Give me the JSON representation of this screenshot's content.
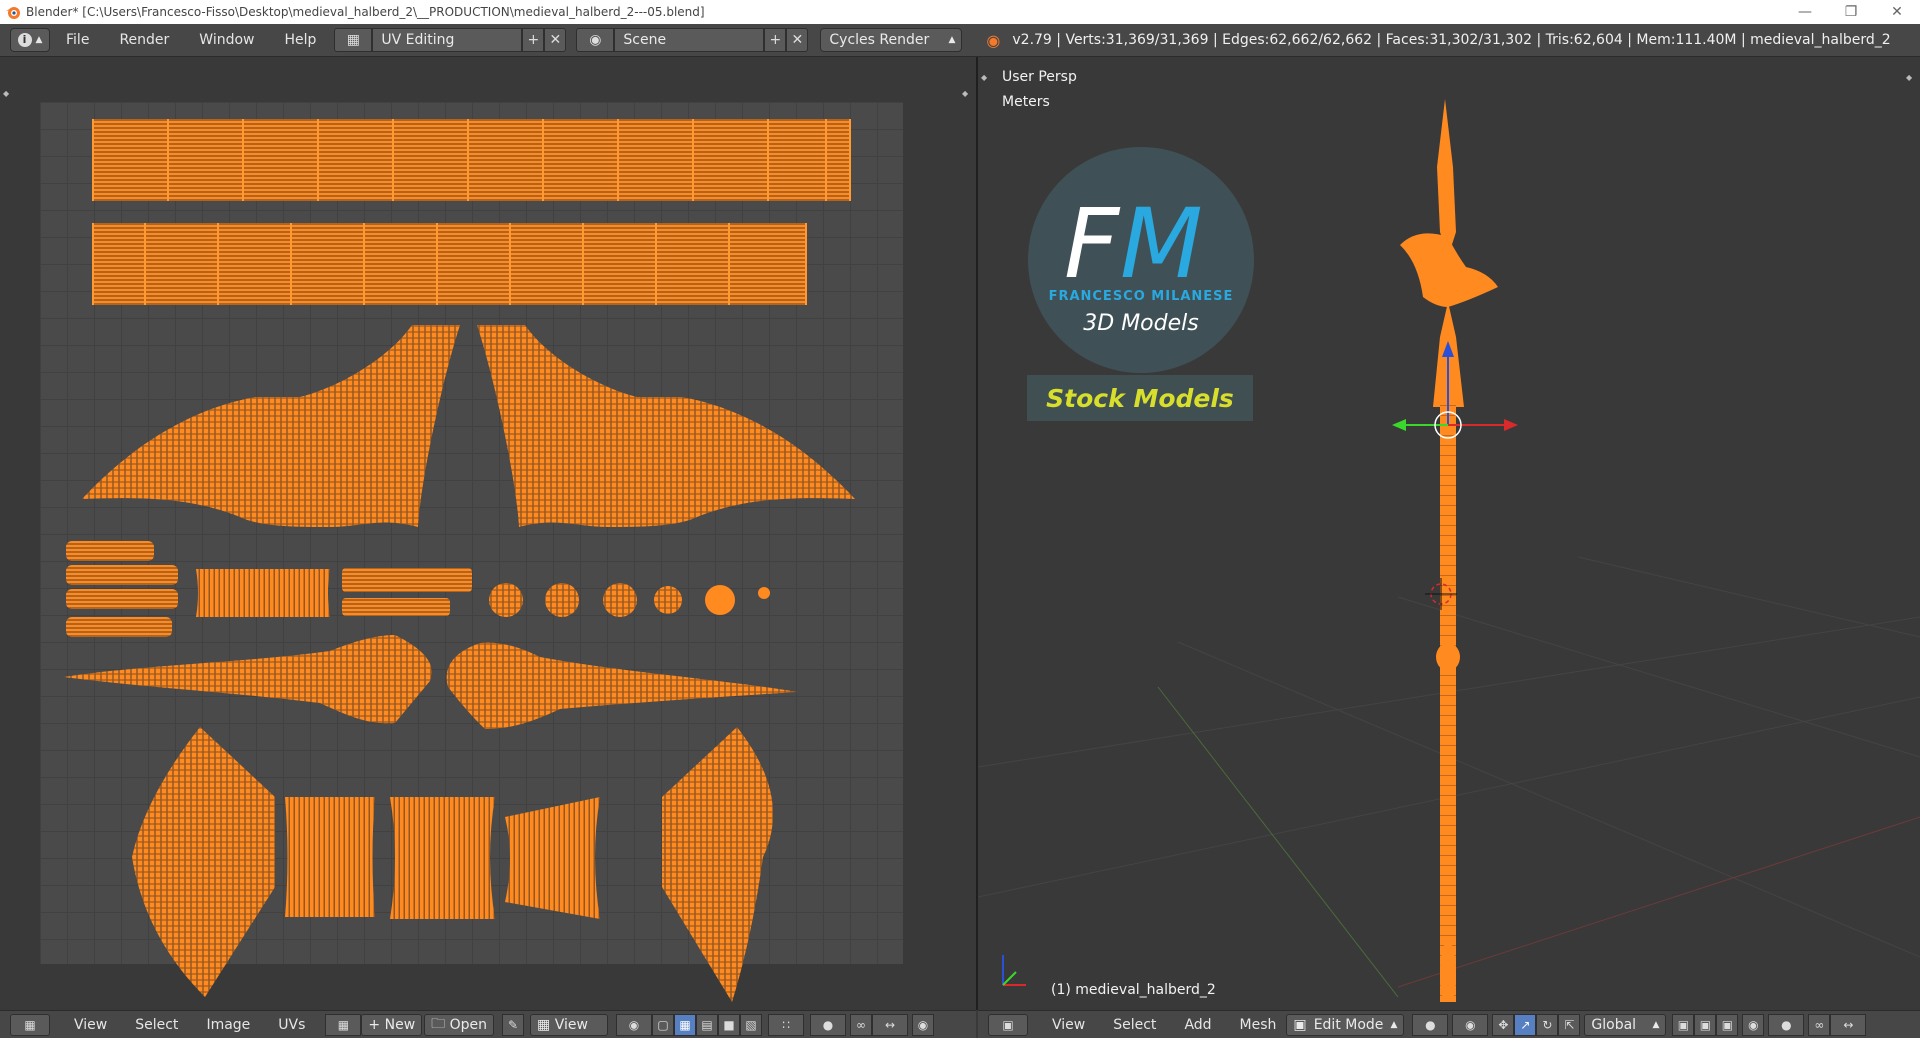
{
  "window": {
    "title": "Blender* [C:\\Users\\Francesco-Fisso\\Desktop\\medieval_halberd_2\\__PRODUCTION\\medieval_halberd_2---05.blend]",
    "minimize_icon": "minimize-icon",
    "restore_icon": "restore-icon",
    "close_icon": "close-icon"
  },
  "menu": {
    "file": "File",
    "render": "Render",
    "window": "Window",
    "help": "Help"
  },
  "layout": {
    "screen_name": "UV Editing",
    "scene_name": "Scene"
  },
  "render_engine": "Cycles Render",
  "stats": "v2.79 | Verts:31,369/31,369 | Edges:62,662/62,662 | Faces:31,302/31,302 | Tris:62,604 | Mem:111.40M | medieval_halberd_2",
  "viewport": {
    "view_label": "User Persp",
    "units_label": "Meters",
    "object_label": "(1) medieval_halberd_2"
  },
  "watermark": {
    "monogram_f": "F",
    "monogram_m": "M",
    "name": "FRANCESCO MILANESE",
    "tagline": "3D Models",
    "badge": "Stock Models"
  },
  "uv_header": {
    "view": "View",
    "select": "Select",
    "image": "Image",
    "uvs": "UVs",
    "new": "New",
    "open": "Open",
    "view2": "View"
  },
  "view3d_header": {
    "view": "View",
    "select": "Select",
    "add": "Add",
    "mesh": "Mesh",
    "mode": "Edit Mode",
    "orientation": "Global"
  },
  "colors": {
    "uv_orange": "#ff8a1f",
    "accent_blue": "#5680c2",
    "fm_blue": "#2aa8e0",
    "badge_yellow": "#d7de2b"
  }
}
